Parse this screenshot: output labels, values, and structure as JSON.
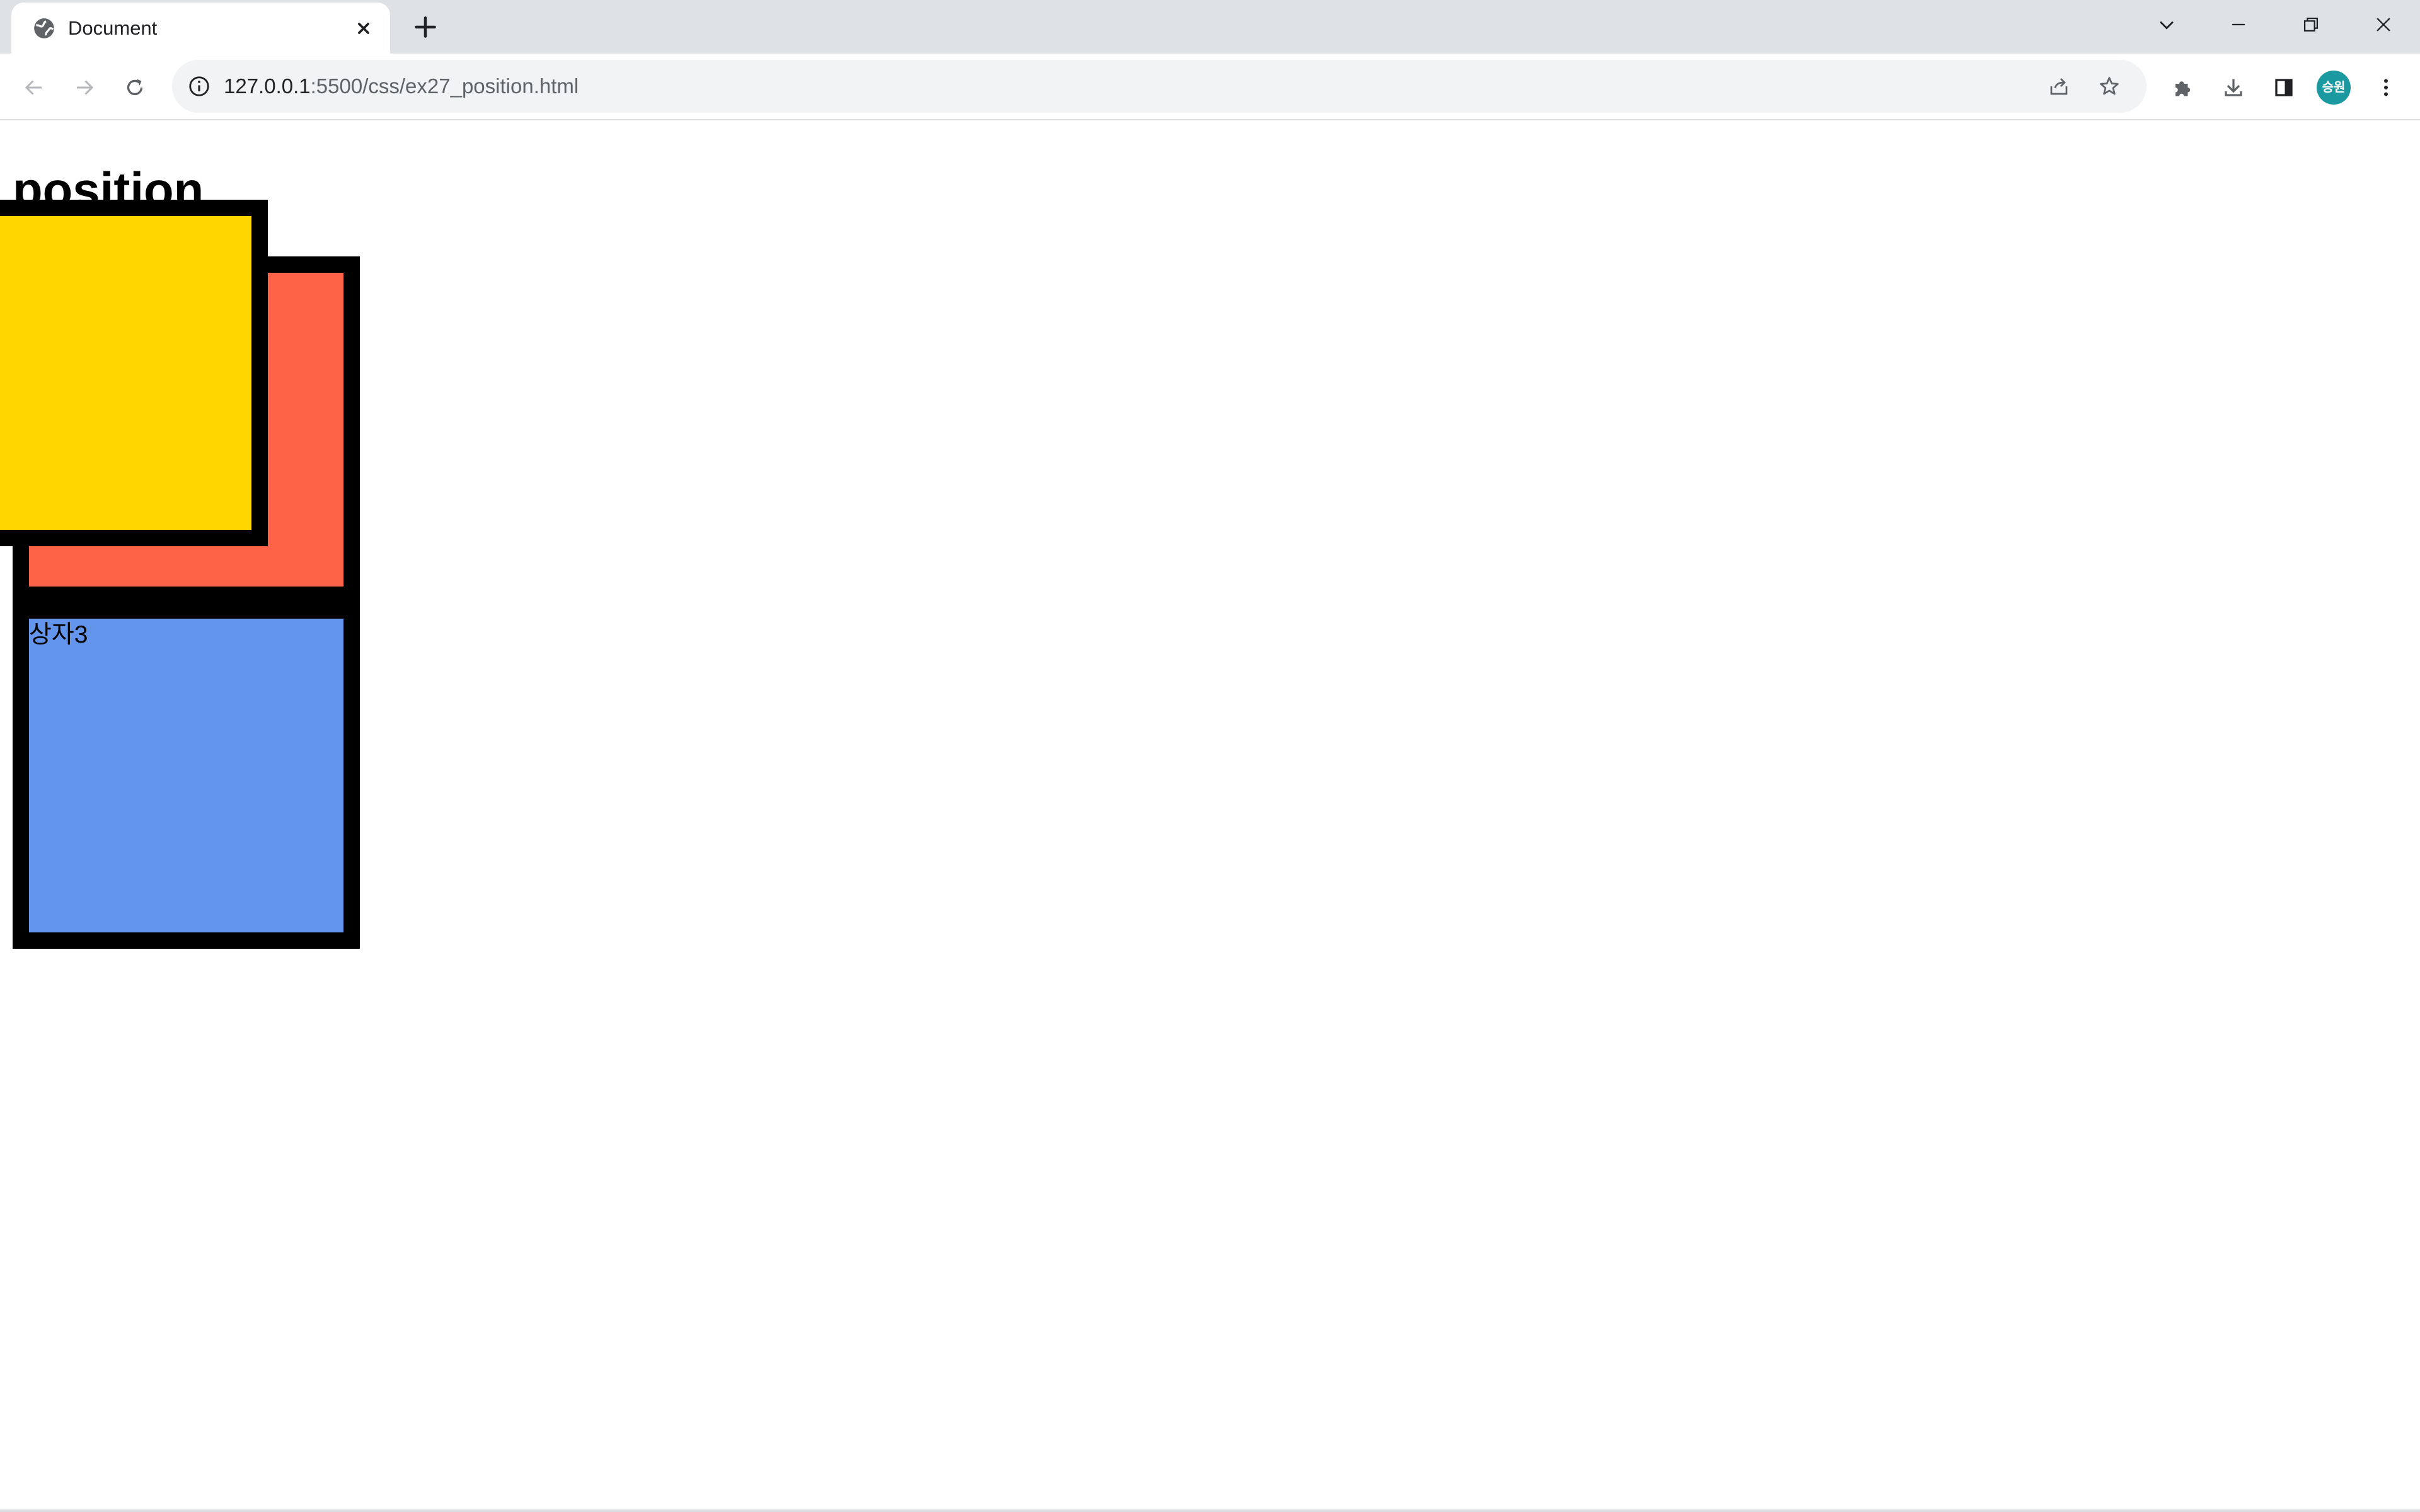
{
  "browser": {
    "tab": {
      "title": "Document"
    },
    "address_bar": {
      "url_host": "127.0.0.1",
      "url_path": ":5500/css/ex27_position.html"
    },
    "profile": {
      "initials": "승원",
      "color": "#1a9aa0"
    }
  },
  "page": {
    "heading": "position",
    "boxes": [
      {
        "id": "box1",
        "label": "",
        "color": "#ffd700"
      },
      {
        "id": "box2",
        "label": "",
        "color": "#ff6347"
      },
      {
        "id": "box3",
        "label": "상자3",
        "color": "#6495ed"
      }
    ]
  },
  "icons": {
    "favicon": "globe-icon",
    "tab_close": "close-icon",
    "new_tab": "plus-icon",
    "tab_search": "chevron-down-icon",
    "minimize": "minimize-icon",
    "restore": "restore-icon",
    "close_window": "close-icon",
    "back": "arrow-left-icon",
    "forward": "arrow-right-icon",
    "reload": "reload-icon",
    "site_info": "info-icon",
    "share": "share-icon",
    "bookmark": "star-icon",
    "extensions": "puzzle-icon",
    "downloads": "download-icon",
    "side_panel": "side-panel-icon",
    "menu": "kebab-menu-icon"
  }
}
